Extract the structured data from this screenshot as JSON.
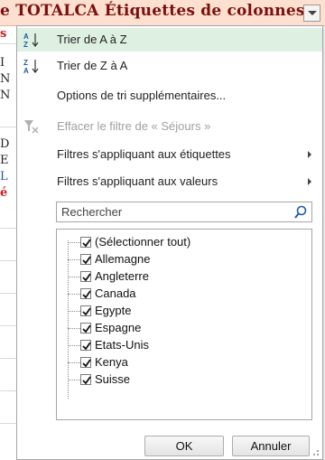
{
  "header": {
    "text": "e TOTALCA    Étiquettes de colonnes",
    "row_fragments": [
      "s",
      "I",
      "N",
      "N",
      "",
      "D",
      "E",
      "L",
      "é"
    ]
  },
  "menu": {
    "items": [
      {
        "label": "Trier de A à Z",
        "icon": "sort-a-z-icon"
      },
      {
        "label": "Trier de Z à A",
        "icon": "sort-z-a-icon"
      },
      {
        "label": "Options de tri supplémentaires...",
        "icon": ""
      },
      {
        "label": "Effacer le filtre de « Séjours »",
        "icon": "clear-filter-icon"
      },
      {
        "label": "Filtres s'appliquant aux étiquettes",
        "icon": ""
      },
      {
        "label": "Filtres s'appliquant aux valeurs",
        "icon": ""
      }
    ]
  },
  "search": {
    "placeholder": "Rechercher"
  },
  "list": {
    "select_all": "(Sélectionner tout)",
    "items": [
      "Allemagne",
      "Angleterre",
      "Canada",
      "Egypte",
      "Espagne",
      "Etats-Unis",
      "Kenya",
      "Suisse"
    ]
  },
  "buttons": {
    "ok": "OK",
    "cancel": "Annuler"
  }
}
